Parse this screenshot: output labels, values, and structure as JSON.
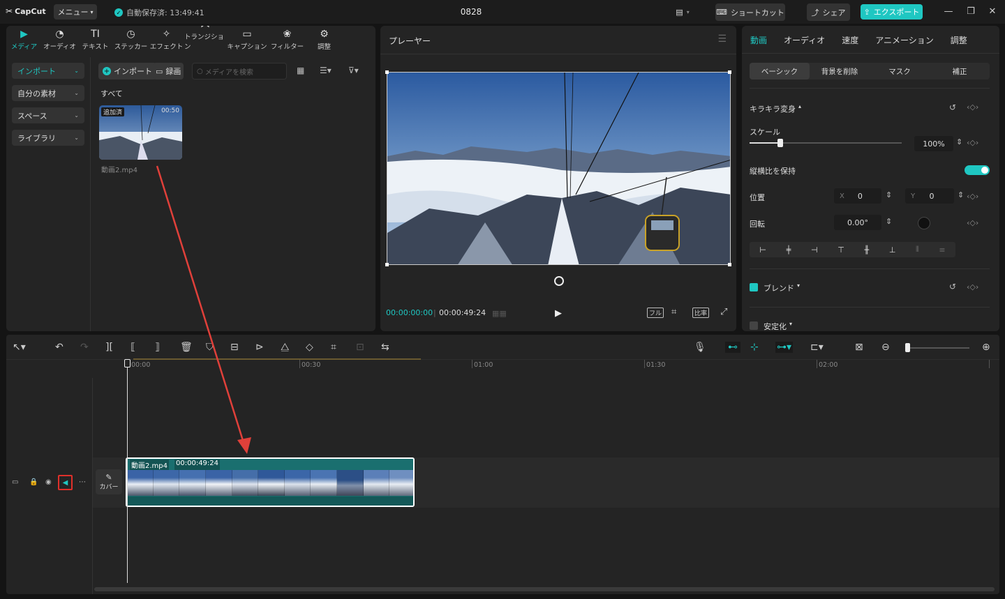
{
  "titlebar": {
    "app_name": "CapCut",
    "menu_label": "メニュー",
    "autosave": "自動保存済: 13:49:41",
    "project_title": "0828",
    "shortcut_label": "ショートカット",
    "share_label": "シェア",
    "export_label": "エクスポート"
  },
  "media": {
    "tool_tabs": [
      {
        "label": "メディア",
        "icon": "media-icon"
      },
      {
        "label": "オーディオ",
        "icon": "audio-icon"
      },
      {
        "label": "テキスト",
        "icon": "text-icon"
      },
      {
        "label": "ステッカー",
        "icon": "sticker-icon"
      },
      {
        "label": "エフェクト",
        "icon": "effect-icon"
      },
      {
        "label": "トランジション",
        "icon": "transition-icon"
      },
      {
        "label": "キャプション",
        "icon": "caption-icon"
      },
      {
        "label": "フィルター",
        "icon": "filter-icon"
      },
      {
        "label": "調整",
        "icon": "adjust-icon"
      }
    ],
    "sidebar": [
      {
        "label": "インポート"
      },
      {
        "label": "自分の素材"
      },
      {
        "label": "スペース"
      },
      {
        "label": "ライブラリ"
      }
    ],
    "import_btn": "インポート",
    "record_btn": "録画",
    "search_placeholder": "メディアを検索",
    "filter_all": "すべて",
    "item": {
      "badge": "追加済",
      "duration": "00:50",
      "filename": "動画2.mp4"
    }
  },
  "player": {
    "title": "プレーヤー",
    "current_time": "00:00:00:00",
    "total_time": "00:00:49:24",
    "full_label": "フル",
    "ratio_label": "比率"
  },
  "props": {
    "tabs": [
      "動画",
      "オーディオ",
      "速度",
      "アニメーション",
      "調整"
    ],
    "subtabs": [
      "ベーシック",
      "背景を削除",
      "マスク",
      "補正"
    ],
    "transform_label": "キラキラ変身",
    "scale_label": "スケール",
    "scale_value": "100%",
    "scale_fraction": 0.2,
    "keep_ratio_label": "縦横比を保持",
    "position_label": "位置",
    "x_label": "X",
    "x_value": "0",
    "y_label": "Y",
    "y_value": "0",
    "rotation_label": "回転",
    "rotation_value": "0.00°",
    "blend_label": "ブレンド",
    "stabilize_label": "安定化",
    "accent_color": "#1fc7c2"
  },
  "timeline": {
    "ruler": [
      "00:00",
      "00:30",
      "01:00",
      "01:30",
      "02:00"
    ],
    "clip_name": "動画2.mp4",
    "clip_duration": "00:00:49:24",
    "cover_label": "カバー"
  }
}
